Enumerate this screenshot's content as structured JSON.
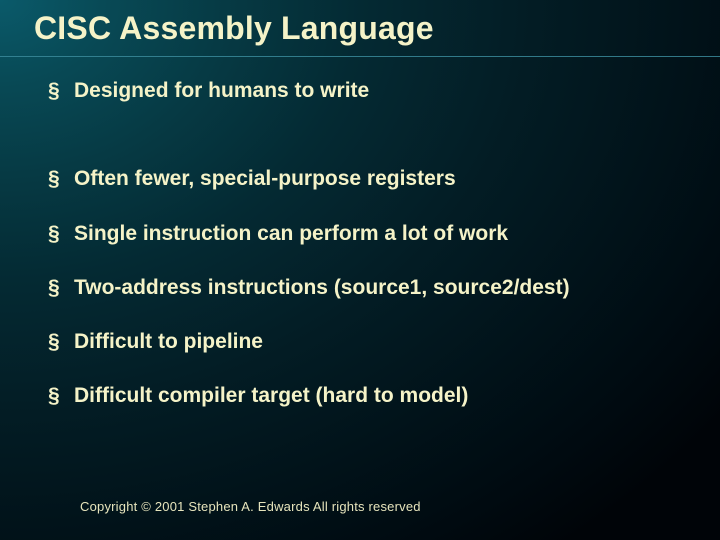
{
  "slide": {
    "title": "CISC Assembly Language",
    "bullets": [
      "Designed for humans to write",
      "Often fewer, special-purpose registers",
      "Single instruction can perform a lot of work",
      "Two-address instructions (source1, source2/dest)",
      "Difficult to pipeline",
      "Difficult compiler target (hard to model)"
    ],
    "footer": "Copyright © 2001 Stephen A. Edwards  All rights reserved"
  }
}
